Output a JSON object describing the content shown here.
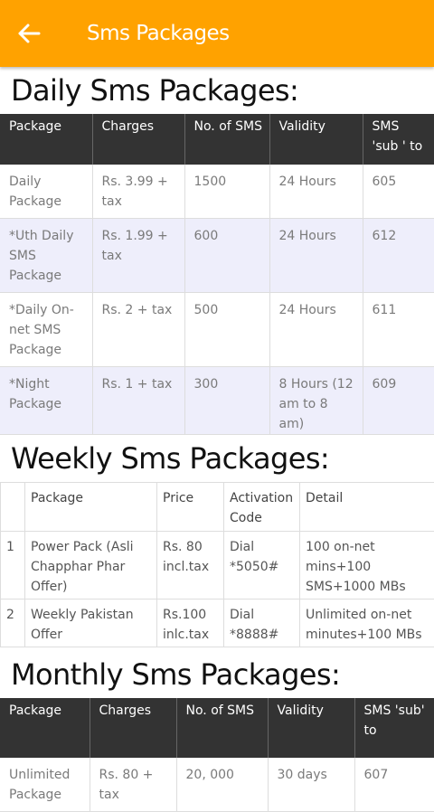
{
  "app_bar": {
    "title": "Sms Packages",
    "back_icon": "arrow-left-icon",
    "color": "#FFA200"
  },
  "daily": {
    "title": "Daily Sms Packages:",
    "headers": [
      "Package",
      "Charges",
      "No. of SMS",
      "Validity",
      "SMS 'sub ' to"
    ],
    "rows": [
      [
        "Daily Package",
        "Rs. 3.99 + tax",
        "1500",
        "24 Hours",
        "605"
      ],
      [
        "*Uth Daily SMS Package",
        "Rs. 1.99 + tax",
        "600",
        "24 Hours",
        "612"
      ],
      [
        "*Daily On-net SMS Package",
        "Rs. 2 + tax",
        "500",
        "24 Hours",
        "611"
      ],
      [
        "*Night Package",
        "Rs. 1 + tax",
        "300",
        "8 Hours (12 am to 8 am)",
        "609"
      ]
    ]
  },
  "weekly": {
    "title": "Weekly Sms Packages:",
    "headers": [
      "",
      "Package",
      "Price",
      "Activation Code",
      "Detail"
    ],
    "rows": [
      [
        "1",
        "Power Pack (Asli Chapphar Phar Offer)",
        "Rs. 80 incl.tax",
        "Dial *5050#",
        "100 on-net mins+100 SMS+1000 MBs"
      ],
      [
        "2",
        "Weekly Pakistan Offer",
        "Rs.100 inlc.tax",
        "Dial *8888#",
        "Unlimited on-net minutes+100 MBs"
      ]
    ]
  },
  "monthly": {
    "title": "Monthly Sms Packages:",
    "headers": [
      "Package",
      "Charges",
      "No. of SMS",
      "Validity",
      "SMS 'sub' to"
    ],
    "rows": [
      [
        "Unlimited Package",
        "Rs. 80 + tax",
        "20, 000",
        "30 days",
        "607"
      ]
    ]
  }
}
